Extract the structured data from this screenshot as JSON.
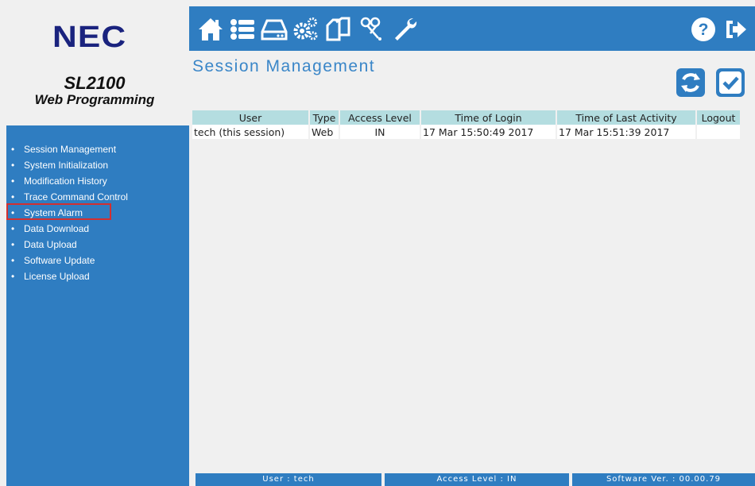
{
  "branding": {
    "logo": "NEC",
    "product": "SL2100",
    "subtitle": "Web Programming"
  },
  "toolbar": {
    "icons": [
      "home-icon",
      "list-icon",
      "drive-icon",
      "settings-gears-icon",
      "copy-pages-icon",
      "scissors-icon",
      "wrench-icon",
      "help-icon",
      "logout-icon"
    ]
  },
  "sidebar": {
    "items": [
      {
        "label": "Session Management"
      },
      {
        "label": "System Initialization"
      },
      {
        "label": "Modification History"
      },
      {
        "label": "Trace Command Control"
      },
      {
        "label": "System Alarm",
        "highlighted": true
      },
      {
        "label": "Data Download"
      },
      {
        "label": "Data Upload"
      },
      {
        "label": "Software Update"
      },
      {
        "label": "License Upload"
      }
    ],
    "bullet": "•"
  },
  "main": {
    "title": "Session Management",
    "actions": [
      "refresh-icon",
      "apply-check-icon"
    ]
  },
  "table": {
    "headers": [
      "User",
      "Type",
      "Access Level",
      "Time of Login",
      "Time of Last Activity",
      "Logout"
    ],
    "rows": [
      [
        "tech (this session)",
        "Web",
        "IN",
        "17 Mar 15:50:49 2017",
        "17 Mar 15:51:39 2017",
        ""
      ]
    ]
  },
  "status_bar": {
    "user": "User : tech",
    "access_level": "Access Level : IN",
    "software_version": "Software Ver. : 00.00.79"
  },
  "colors": {
    "brand_blue": "#2f7dc1",
    "logo_navy": "#1a237e",
    "table_header": "#b4dde0",
    "highlight_red": "#d32f2f"
  }
}
